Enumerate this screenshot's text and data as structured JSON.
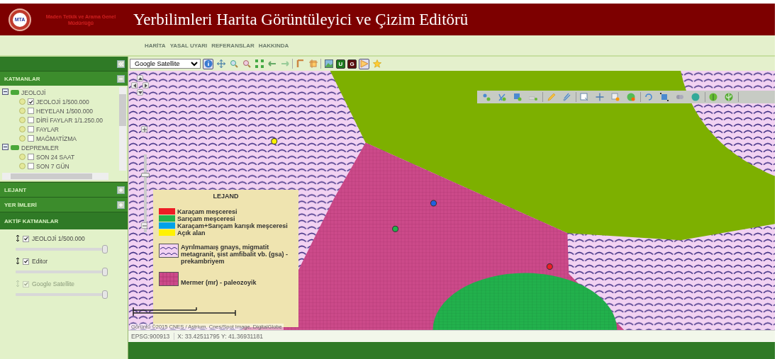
{
  "header": {
    "logo_text": "MTA",
    "organization": "Maden Tetkik ve Arama Genel Müdürlüğü",
    "title": "Yerbilimleri Harita Görüntüleyici ve Çizim Editörü"
  },
  "nav": [
    "HARİTA",
    "YASAL UYARI",
    "REFERANSLAR",
    "HAKKINDA"
  ],
  "sidebar": {
    "panels": [
      {
        "kind": "tree",
        "title": "KATMANLAR",
        "expanded": true,
        "groups": [
          {
            "label": "JEOLOJİ",
            "expanded": true,
            "children": [
              {
                "label": "JEOLOJİ 1/500.000",
                "checked": true
              },
              {
                "label": "HEYELAN 1/500.000",
                "checked": false
              },
              {
                "label": "DİRİ FAYLAR 1/1.250.00",
                "checked": false
              },
              {
                "label": "FAYLAR",
                "checked": false
              },
              {
                "label": "MAĞMATİZMA",
                "checked": false
              }
            ]
          },
          {
            "label": "DEPREMLER",
            "expanded": true,
            "children": [
              {
                "label": "SON 24 SAAT",
                "checked": false
              },
              {
                "label": "SON 7 GÜN",
                "checked": false
              }
            ]
          }
        ]
      },
      {
        "kind": "collapsible",
        "title": "LEJANT",
        "expanded": false
      },
      {
        "kind": "collapsible",
        "title": "YER İMLERİ",
        "expanded": false
      },
      {
        "kind": "active",
        "title": "AKTİF KATMANLAR",
        "layers": [
          {
            "label": "JEOLOJİ 1/500.000",
            "checked": true,
            "disabled": false,
            "level": 1
          },
          {
            "label": "Editor",
            "checked": true,
            "disabled": false,
            "level": 1
          },
          {
            "label": "Google Satellite",
            "checked": true,
            "disabled": true,
            "level": 1
          }
        ]
      }
    ]
  },
  "map": {
    "base_layer": "Google Satellite",
    "toolbar": [
      {
        "kind": "info",
        "selected": true
      },
      {
        "kind": "pan",
        "selected": false
      },
      {
        "kind": "zoom-in",
        "selected": false
      },
      {
        "kind": "zoom-out",
        "selected": false
      },
      {
        "kind": "extent",
        "selected": false
      },
      {
        "kind": "back",
        "selected": false
      },
      {
        "kind": "forward",
        "selected": false
      },
      {
        "kind": "separator"
      },
      {
        "kind": "measure",
        "selected": false
      },
      {
        "kind": "area",
        "selected": false
      },
      {
        "kind": "separator"
      },
      {
        "kind": "image",
        "selected": false
      },
      {
        "kind": "letter",
        "text": "U",
        "color": "#1e7a1e",
        "selected": false
      },
      {
        "kind": "letter",
        "text": "G",
        "color": "#5a1010",
        "selected": false
      },
      {
        "kind": "ruler",
        "selected": true
      },
      {
        "kind": "star",
        "selected": false
      }
    ],
    "zoom": {
      "level": 0.75
    },
    "legend": {
      "title": "LEJAND",
      "items": [
        {
          "kind": "swatch",
          "color": "#ed1c24",
          "label": "Karaçam meşceresi"
        },
        {
          "kind": "swatch",
          "color": "#22b14c",
          "label": "Sarıçam meşceresi"
        },
        {
          "kind": "swatch",
          "color": "#00a2e8",
          "label": "Karaçam+Sarıçam karışık meşceresi"
        },
        {
          "kind": "swatch",
          "color": "#fff200",
          "label": "Açık alan"
        },
        {
          "kind": "wave",
          "label": "Ayrılmamaış gnays, migmatit metagranit, şist amfibalit vb. (gsa) - prekambriyem"
        },
        {
          "kind": "grid",
          "label": "Mermer (mr) - paleozoyik"
        }
      ]
    },
    "markers": [
      {
        "color": "#fff200"
      },
      {
        "color": "#2060e0"
      },
      {
        "color": "#22b14c"
      },
      {
        "color": "#ed1c24"
      }
    ],
    "attribution": "Görüntü ©2015 CNES / Astrium, Cnes/Spot Image, DigitalGlobe"
  },
  "status_bar": {
    "projection": "EPSG:900913",
    "coordinates": "X: 33.42511795 Y: 41.36931181"
  }
}
